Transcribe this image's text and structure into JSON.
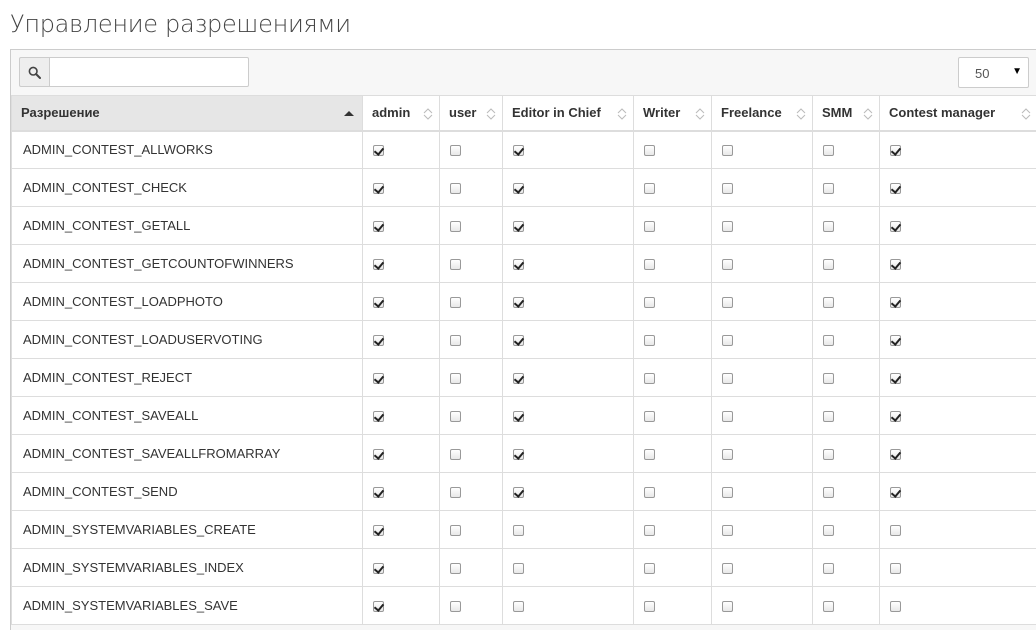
{
  "page": {
    "title": "Управление разрешениями"
  },
  "search": {
    "placeholder": "",
    "value": ""
  },
  "page_size": {
    "value": "50"
  },
  "table": {
    "columns": [
      "Разрешение",
      "admin",
      "user",
      "Editor in Chief",
      "Writer",
      "Freelance",
      "SMM",
      "Contest manager"
    ],
    "rows": [
      {
        "name": "ADMIN_CONTEST_ALLWORKS",
        "perms": [
          true,
          false,
          true,
          false,
          false,
          false,
          true
        ]
      },
      {
        "name": "ADMIN_CONTEST_CHECK",
        "perms": [
          true,
          false,
          true,
          false,
          false,
          false,
          true
        ]
      },
      {
        "name": "ADMIN_CONTEST_GETALL",
        "perms": [
          true,
          false,
          true,
          false,
          false,
          false,
          true
        ]
      },
      {
        "name": "ADMIN_CONTEST_GETCOUNTOFWINNERS",
        "perms": [
          true,
          false,
          true,
          false,
          false,
          false,
          true
        ]
      },
      {
        "name": "ADMIN_CONTEST_LOADPHOTO",
        "perms": [
          true,
          false,
          true,
          false,
          false,
          false,
          true
        ]
      },
      {
        "name": "ADMIN_CONTEST_LOADUSERVOTING",
        "perms": [
          true,
          false,
          true,
          false,
          false,
          false,
          true
        ]
      },
      {
        "name": "ADMIN_CONTEST_REJECT",
        "perms": [
          true,
          false,
          true,
          false,
          false,
          false,
          true
        ]
      },
      {
        "name": "ADMIN_CONTEST_SAVEALL",
        "perms": [
          true,
          false,
          true,
          false,
          false,
          false,
          true
        ]
      },
      {
        "name": "ADMIN_CONTEST_SAVEALLFROMARRAY",
        "perms": [
          true,
          false,
          true,
          false,
          false,
          false,
          true
        ]
      },
      {
        "name": "ADMIN_CONTEST_SEND",
        "perms": [
          true,
          false,
          true,
          false,
          false,
          false,
          true
        ]
      },
      {
        "name": "ADMIN_SYSTEMVARIABLES_CREATE",
        "perms": [
          true,
          false,
          false,
          false,
          false,
          false,
          false
        ]
      },
      {
        "name": "ADMIN_SYSTEMVARIABLES_INDEX",
        "perms": [
          true,
          false,
          false,
          false,
          false,
          false,
          false
        ]
      },
      {
        "name": "ADMIN_SYSTEMVARIABLES_SAVE",
        "perms": [
          true,
          false,
          false,
          false,
          false,
          false,
          false
        ]
      }
    ]
  }
}
